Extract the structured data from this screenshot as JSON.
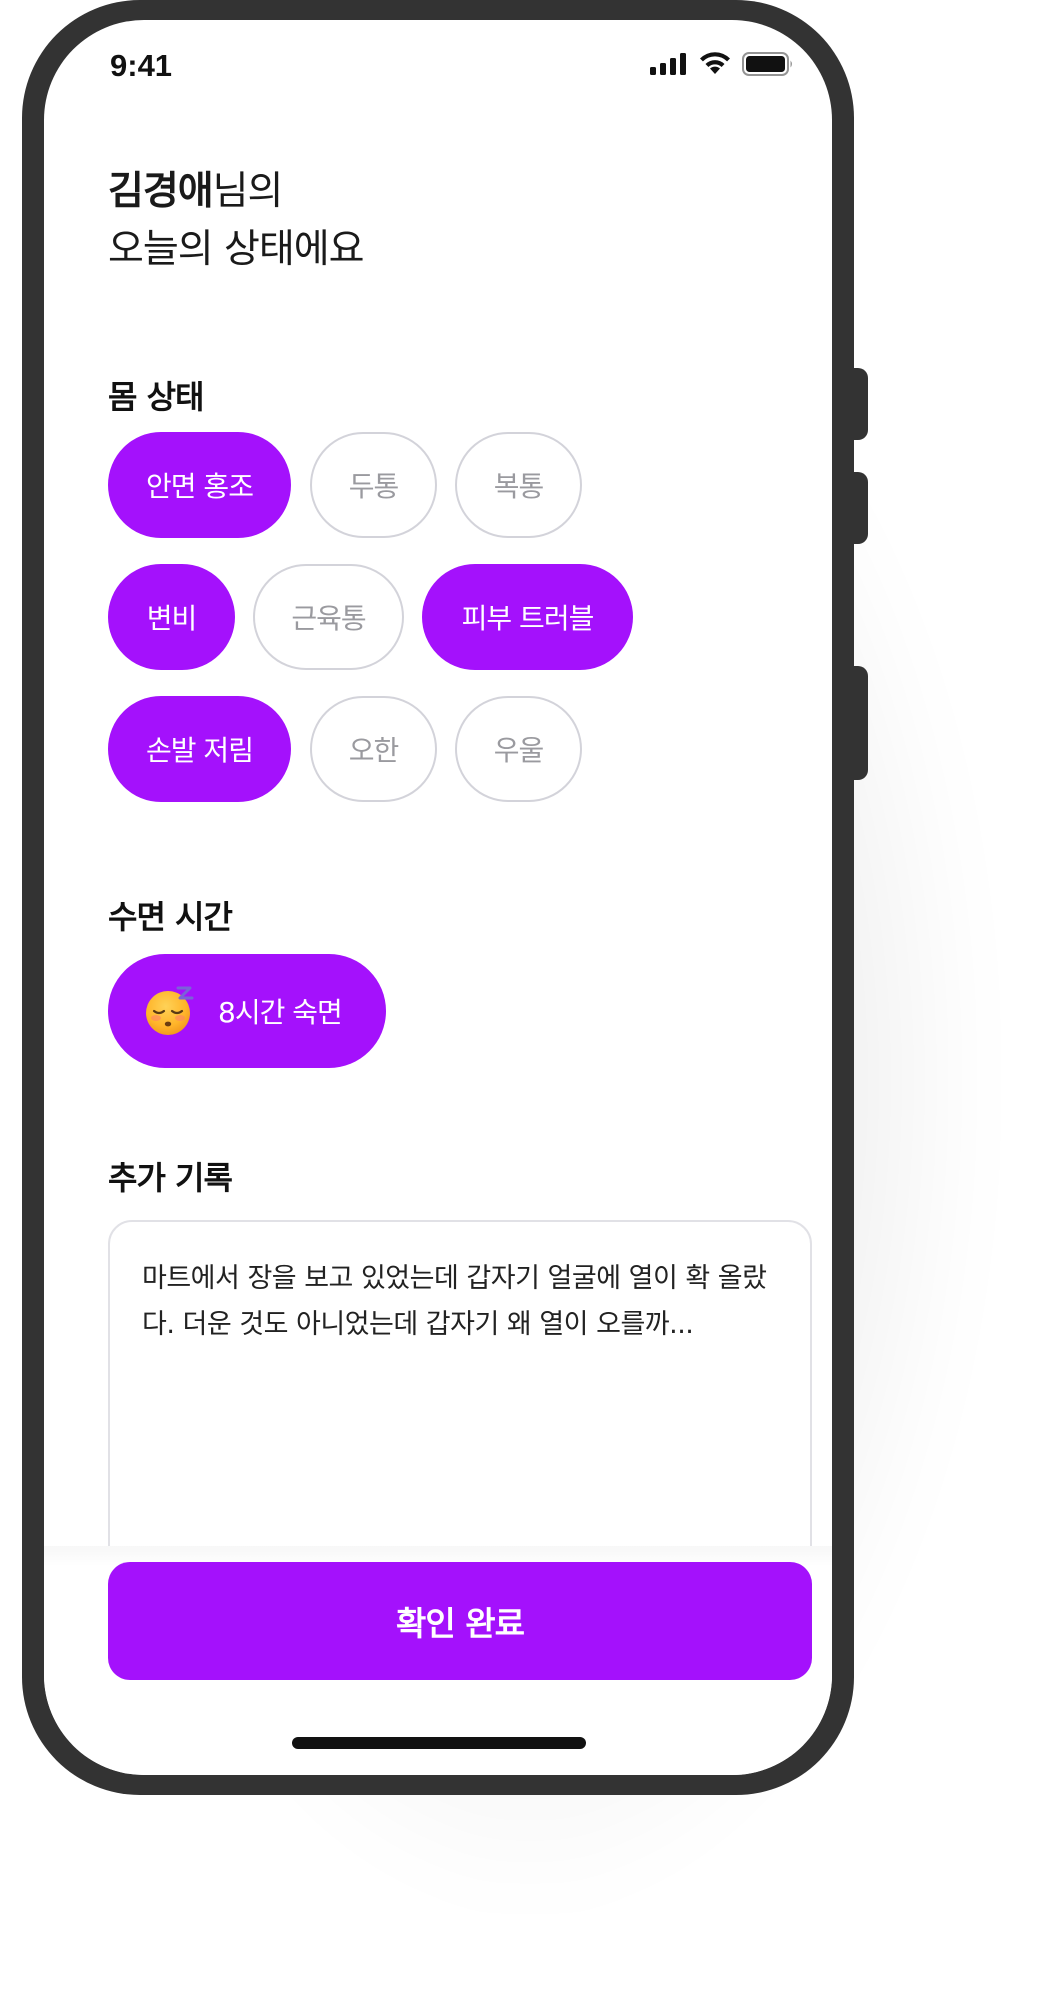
{
  "status_bar": {
    "time": "9:41",
    "icons": [
      "cellular-signal-icon",
      "wifi-icon",
      "battery-icon"
    ]
  },
  "greeting": {
    "name": "김경애",
    "suffix": "님의",
    "line2": "오늘의 상태에요"
  },
  "body_status": {
    "title": "몸 상태",
    "chips": [
      {
        "label": "안면 홍조",
        "selected": true
      },
      {
        "label": "두통",
        "selected": false
      },
      {
        "label": "복통",
        "selected": false
      },
      {
        "label": "변비",
        "selected": true
      },
      {
        "label": "근육통",
        "selected": false
      },
      {
        "label": "피부 트러블",
        "selected": true
      },
      {
        "label": "손발 저림",
        "selected": true
      },
      {
        "label": "오한",
        "selected": false
      },
      {
        "label": "우울",
        "selected": false
      }
    ]
  },
  "sleep": {
    "title": "수면 시간",
    "icon": "sleeping-face-icon",
    "value_label": "8시간 숙면"
  },
  "memo": {
    "title": "추가 기록",
    "text": "마트에서 장을 보고 있었는데 갑자기 얼굴에 열이 확 올랐다. 더운 것도 아니었는데 갑자기 왜 열이 오를까..."
  },
  "confirm_button": {
    "label": "확인 완료"
  },
  "colors": {
    "accent": "#a411fc",
    "chip_border": "#d3d3da",
    "chip_text_off": "#9a9a9f",
    "frame": "#333333"
  }
}
